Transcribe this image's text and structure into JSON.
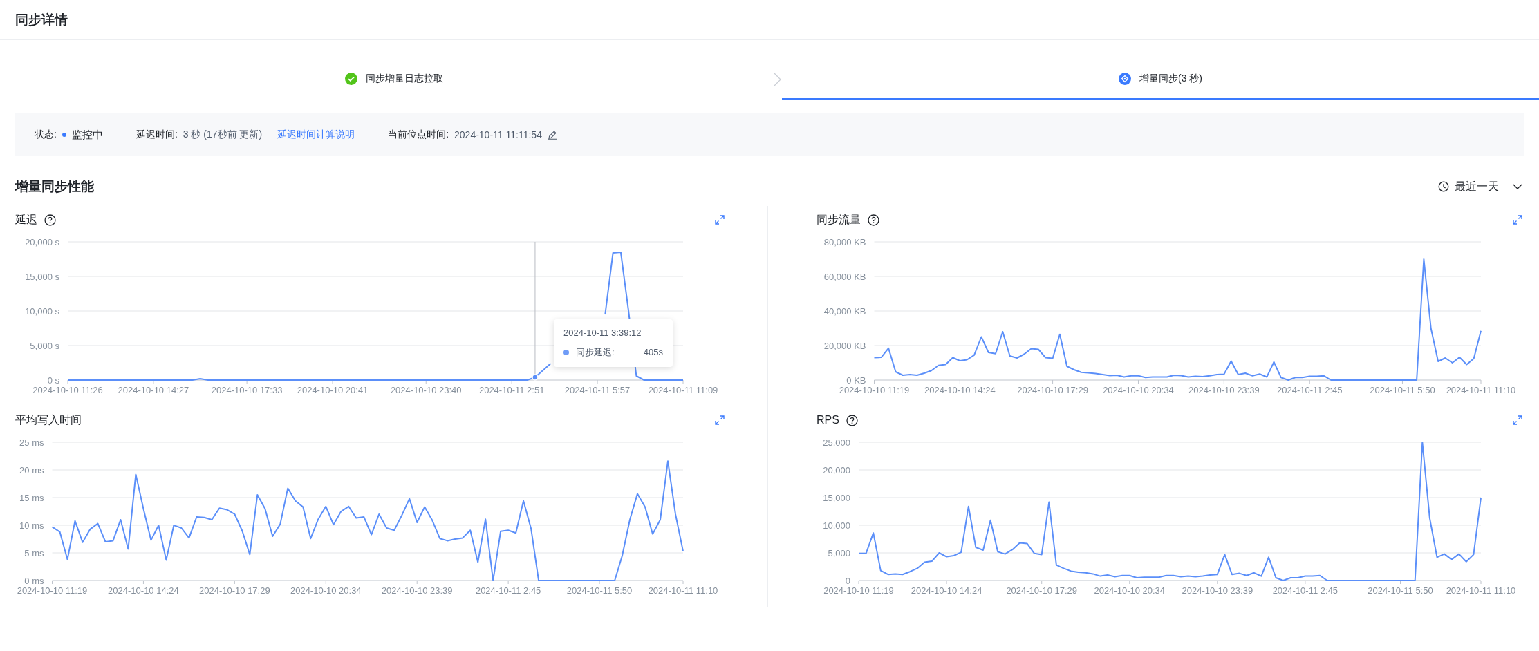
{
  "page": {
    "title": "同步详情"
  },
  "steps": [
    {
      "label": "同步增量日志拉取",
      "completed": true,
      "selected": false
    },
    {
      "label": "增量同步(3 秒)",
      "completed": false,
      "selected": true
    }
  ],
  "status_bar": {
    "state_label": "状态:",
    "state": "监控中",
    "delay_label": "延迟时间:",
    "delay_value": "3 秒 (17秒前 更新)",
    "delay_help_link": "延迟时间计算说明",
    "position_label": "当前位点时间:",
    "position_value": "2024-10-11 11:11:54"
  },
  "section": {
    "title": "增量同步性能",
    "time_range": "最近一天"
  },
  "charts": [
    {
      "title": "延迟",
      "help": true,
      "tooltip": {
        "time": "2024-10-11 3:39:12",
        "label": "同步延迟:",
        "value": "405s"
      },
      "chart_data": {
        "type": "line",
        "grid": true,
        "ylim": [
          0,
          20000
        ],
        "yticks": [
          {
            "value": 0,
            "label": "0 s"
          },
          {
            "value": 5000,
            "label": "5,000 s"
          },
          {
            "value": 10000,
            "label": "10,000 s"
          },
          {
            "value": 15000,
            "label": "15,000 s"
          },
          {
            "value": 20000,
            "label": "20,000 s"
          }
        ],
        "categories": [
          "2024-10-10 11:26",
          null,
          null,
          null,
          null,
          null,
          null,
          null,
          null,
          null,
          null,
          "2024-10-10 14:27",
          null,
          null,
          null,
          null,
          null,
          null,
          null,
          null,
          null,
          null,
          null,
          "2024-10-10 17:33",
          null,
          null,
          null,
          null,
          null,
          null,
          null,
          null,
          null,
          null,
          "2024-10-10 20:41",
          null,
          null,
          null,
          null,
          null,
          null,
          null,
          null,
          null,
          null,
          null,
          "2024-10-10 23:40",
          null,
          null,
          null,
          null,
          null,
          null,
          null,
          null,
          null,
          null,
          "2024-10-11 2:51",
          null,
          null,
          null,
          null,
          null,
          null,
          null,
          null,
          null,
          null,
          "2024-10-11 5:57",
          null,
          null,
          null,
          null,
          null,
          null,
          null,
          null,
          null,
          null,
          "2024-10-11 11:09"
        ],
        "series": [
          {
            "color": "#5b8ff9",
            "values": [
              0,
              0,
              0,
              0,
              0,
              0,
              0,
              0,
              0,
              0,
              0,
              0,
              0,
              0,
              0,
              0,
              0,
              200,
              0,
              0,
              0,
              0,
              0,
              0,
              0,
              0,
              0,
              0,
              0,
              0,
              0,
              0,
              0,
              0,
              0,
              0,
              0,
              0,
              0,
              0,
              0,
              0,
              0,
              0,
              0,
              0,
              0,
              0,
              0,
              0,
              0,
              0,
              0,
              0,
              0,
              0,
              0,
              0,
              0,
              0,
              405,
              1400,
              2400,
              null,
              null,
              null,
              null,
              null,
              null,
              9500,
              18400,
              18500,
              10000,
              600,
              0,
              0,
              0,
              0,
              0,
              0
            ]
          }
        ]
      }
    },
    {
      "title": "同步流量",
      "help": true,
      "chart_data": {
        "type": "line",
        "grid": true,
        "ylim": [
          0,
          80000
        ],
        "yticks": [
          {
            "value": 0,
            "label": "0 KB"
          },
          {
            "value": 20000,
            "label": "20,000 KB"
          },
          {
            "value": 40000,
            "label": "40,000 KB"
          },
          {
            "value": 60000,
            "label": "60,000 KB"
          },
          {
            "value": 80000,
            "label": "80,000 KB"
          }
        ],
        "categories": [
          "2024-10-10 11:19",
          null,
          null,
          null,
          null,
          null,
          null,
          null,
          null,
          null,
          null,
          null,
          "2024-10-10 14:24",
          null,
          null,
          null,
          null,
          null,
          null,
          null,
          null,
          null,
          null,
          null,
          null,
          "2024-10-10 17:29",
          null,
          null,
          null,
          null,
          null,
          null,
          null,
          null,
          null,
          null,
          null,
          "2024-10-10 20:34",
          null,
          null,
          null,
          null,
          null,
          null,
          null,
          null,
          null,
          null,
          null,
          "2024-10-10 23:39",
          null,
          null,
          null,
          null,
          null,
          null,
          null,
          null,
          null,
          null,
          null,
          "2024-10-11 2:45",
          null,
          null,
          null,
          null,
          null,
          null,
          null,
          null,
          null,
          null,
          null,
          null,
          "2024-10-11 5:50",
          null,
          null,
          null,
          null,
          null,
          null,
          null,
          null,
          null,
          null,
          "2024-10-11 11:10"
        ],
        "series": [
          {
            "color": "#5b8ff9",
            "values": [
              13000,
              13200,
              18500,
              4800,
              2800,
              3200,
              2800,
              4000,
              5500,
              8500,
              9000,
              13000,
              11200,
              11800,
              14500,
              25000,
              16000,
              15300,
              28000,
              14000,
              12800,
              15000,
              18200,
              17800,
              13000,
              12600,
              26500,
              8000,
              6000,
              4500,
              4200,
              3800,
              3200,
              2600,
              2800,
              1800,
              2500,
              2500,
              1500,
              1800,
              1800,
              1800,
              2800,
              2600,
              1800,
              2200,
              2000,
              2500,
              3200,
              3400,
              11000,
              3200,
              4000,
              2500,
              3500,
              1800,
              10500,
              1500,
              0,
              1500,
              1500,
              2200,
              2200,
              2500,
              0,
              0,
              0,
              0,
              0,
              0,
              0,
              0,
              0,
              0,
              0,
              0,
              0,
              70000,
              30000,
              10800,
              12800,
              10000,
              13200,
              9000,
              12500,
              28500
            ]
          }
        ]
      }
    },
    {
      "title": "平均写入时间",
      "help": false,
      "chart_data": {
        "type": "line",
        "grid": true,
        "ylim": [
          0,
          25
        ],
        "yticks": [
          {
            "value": 0,
            "label": "0 ms"
          },
          {
            "value": 5,
            "label": "5 ms"
          },
          {
            "value": 10,
            "label": "10 ms"
          },
          {
            "value": 15,
            "label": "15 ms"
          },
          {
            "value": 20,
            "label": "20 ms"
          },
          {
            "value": 25,
            "label": "25 ms"
          }
        ],
        "categories": [
          "2024-10-10 11:19",
          null,
          null,
          null,
          null,
          null,
          null,
          null,
          null,
          null,
          null,
          null,
          "2024-10-10 14:24",
          null,
          null,
          null,
          null,
          null,
          null,
          null,
          null,
          null,
          null,
          null,
          "2024-10-10 17:29",
          null,
          null,
          null,
          null,
          null,
          null,
          null,
          null,
          null,
          null,
          null,
          "2024-10-10 20:34",
          null,
          null,
          null,
          null,
          null,
          null,
          null,
          null,
          null,
          null,
          null,
          "2024-10-10 23:39",
          null,
          null,
          null,
          null,
          null,
          null,
          null,
          null,
          null,
          null,
          null,
          "2024-10-11 2:45",
          null,
          null,
          null,
          null,
          null,
          null,
          null,
          null,
          null,
          null,
          null,
          "2024-10-11 5:50",
          null,
          null,
          null,
          null,
          null,
          null,
          null,
          null,
          null,
          null,
          "2024-10-11 11:10"
        ],
        "series": [
          {
            "color": "#5b8ff9",
            "values": [
              9.7,
              8.8,
              3.8,
              10.8,
              6.9,
              9.3,
              10.3,
              7.0,
              7.2,
              11.0,
              5.7,
              19.2,
              13.0,
              7.3,
              10.0,
              3.7,
              10.0,
              9.5,
              7.7,
              11.5,
              11.4,
              11.0,
              13.1,
              12.8,
              12.0,
              9.0,
              4.7,
              15.5,
              13.0,
              8.0,
              10.2,
              16.7,
              14.4,
              13.3,
              7.6,
              11.1,
              13.4,
              10.1,
              12.5,
              13.4,
              11.3,
              11.5,
              8.3,
              12.0,
              9.5,
              9.1,
              11.8,
              14.8,
              10.5,
              13.3,
              10.9,
              7.6,
              7.2,
              7.5,
              7.7,
              9.1,
              3.3,
              11.1,
              0,
              8.9,
              9.1,
              8.6,
              14.4,
              9.4,
              0,
              0,
              0,
              0,
              0,
              0,
              0,
              0,
              0,
              0,
              0,
              4.5,
              11,
              15.7,
              13.3,
              8.4,
              11,
              21.6,
              12,
              5.3
            ]
          }
        ]
      }
    },
    {
      "title": "RPS",
      "help": true,
      "chart_data": {
        "type": "line",
        "grid": true,
        "ylim": [
          0,
          25000
        ],
        "yticks": [
          {
            "value": 0,
            "label": "0"
          },
          {
            "value": 5000,
            "label": "5,000"
          },
          {
            "value": 10000,
            "label": "10,000"
          },
          {
            "value": 15000,
            "label": "15,000"
          },
          {
            "value": 20000,
            "label": "20,000"
          },
          {
            "value": 25000,
            "label": "25,000"
          }
        ],
        "categories": [
          "2024-10-10 11:19",
          null,
          null,
          null,
          null,
          null,
          null,
          null,
          null,
          null,
          null,
          null,
          "2024-10-10 14:24",
          null,
          null,
          null,
          null,
          null,
          null,
          null,
          null,
          null,
          null,
          null,
          null,
          "2024-10-10 17:29",
          null,
          null,
          null,
          null,
          null,
          null,
          null,
          null,
          null,
          null,
          null,
          "2024-10-10 20:34",
          null,
          null,
          null,
          null,
          null,
          null,
          null,
          null,
          null,
          null,
          null,
          "2024-10-10 23:39",
          null,
          null,
          null,
          null,
          null,
          null,
          null,
          null,
          null,
          null,
          null,
          "2024-10-11 2:45",
          null,
          null,
          null,
          null,
          null,
          null,
          null,
          null,
          null,
          null,
          null,
          null,
          "2024-10-11 5:50",
          null,
          null,
          null,
          null,
          null,
          null,
          null,
          null,
          null,
          null,
          "2024-10-11 11:10"
        ],
        "series": [
          {
            "color": "#5b8ff9",
            "values": [
              4900,
              4900,
              8600,
              1800,
              1100,
              1200,
              1100,
              1600,
              2200,
              3300,
              3500,
              5000,
              4300,
              4500,
              5100,
              13400,
              6000,
              5500,
              10900,
              5200,
              4800,
              5600,
              6800,
              6700,
              4900,
              4700,
              14200,
              2800,
              2200,
              1700,
              1500,
              1400,
              1200,
              800,
              1000,
              700,
              900,
              900,
              500,
              600,
              600,
              600,
              900,
              900,
              700,
              800,
              700,
              800,
              1000,
              1100,
              4700,
              1100,
              1300,
              900,
              1400,
              800,
              4200,
              500,
              0,
              500,
              500,
              800,
              800,
              900,
              0,
              0,
              0,
              0,
              0,
              0,
              0,
              0,
              0,
              0,
              0,
              0,
              0,
              25000,
              11300,
              4200,
              4800,
              3800,
              4800,
              3400,
              4700,
              15000
            ]
          }
        ]
      }
    }
  ]
}
